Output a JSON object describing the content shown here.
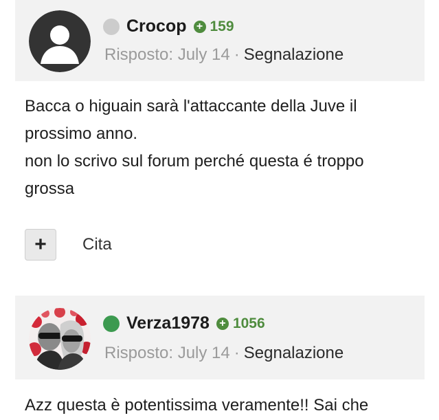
{
  "posts": [
    {
      "username": "Crocop",
      "status_color": "#cccccc",
      "reputation": "159",
      "reputation_icon": "plus-circle-icon",
      "replied_label": "Risposto: July 14",
      "separator": "·",
      "report_label": "Segnalazione",
      "avatar": "default-person-icon",
      "body_lines": [
        "Bacca o higuain sarà l'attaccante della Juve il",
        "prossimo anno.",
        "non lo scrivo sul forum perché questa é troppo",
        "grossa"
      ],
      "actions": {
        "plus_icon": "plus-icon",
        "quote_label": "Cita"
      }
    },
    {
      "username": "Verza1978",
      "status_color": "#3c9a50",
      "reputation": "1056",
      "reputation_icon": "plus-circle-icon",
      "replied_label": "Risposto: July 14",
      "separator": "·",
      "report_label": "Segnalazione",
      "avatar": "photo-avatar",
      "body_lines": [
        "Azz questa è potentissima veramente!! Sai che"
      ]
    }
  ],
  "colors": {
    "header_bg": "#f2f2f2",
    "rep_green": "#4f8c3e",
    "meta_gray": "#9a9a9a"
  }
}
